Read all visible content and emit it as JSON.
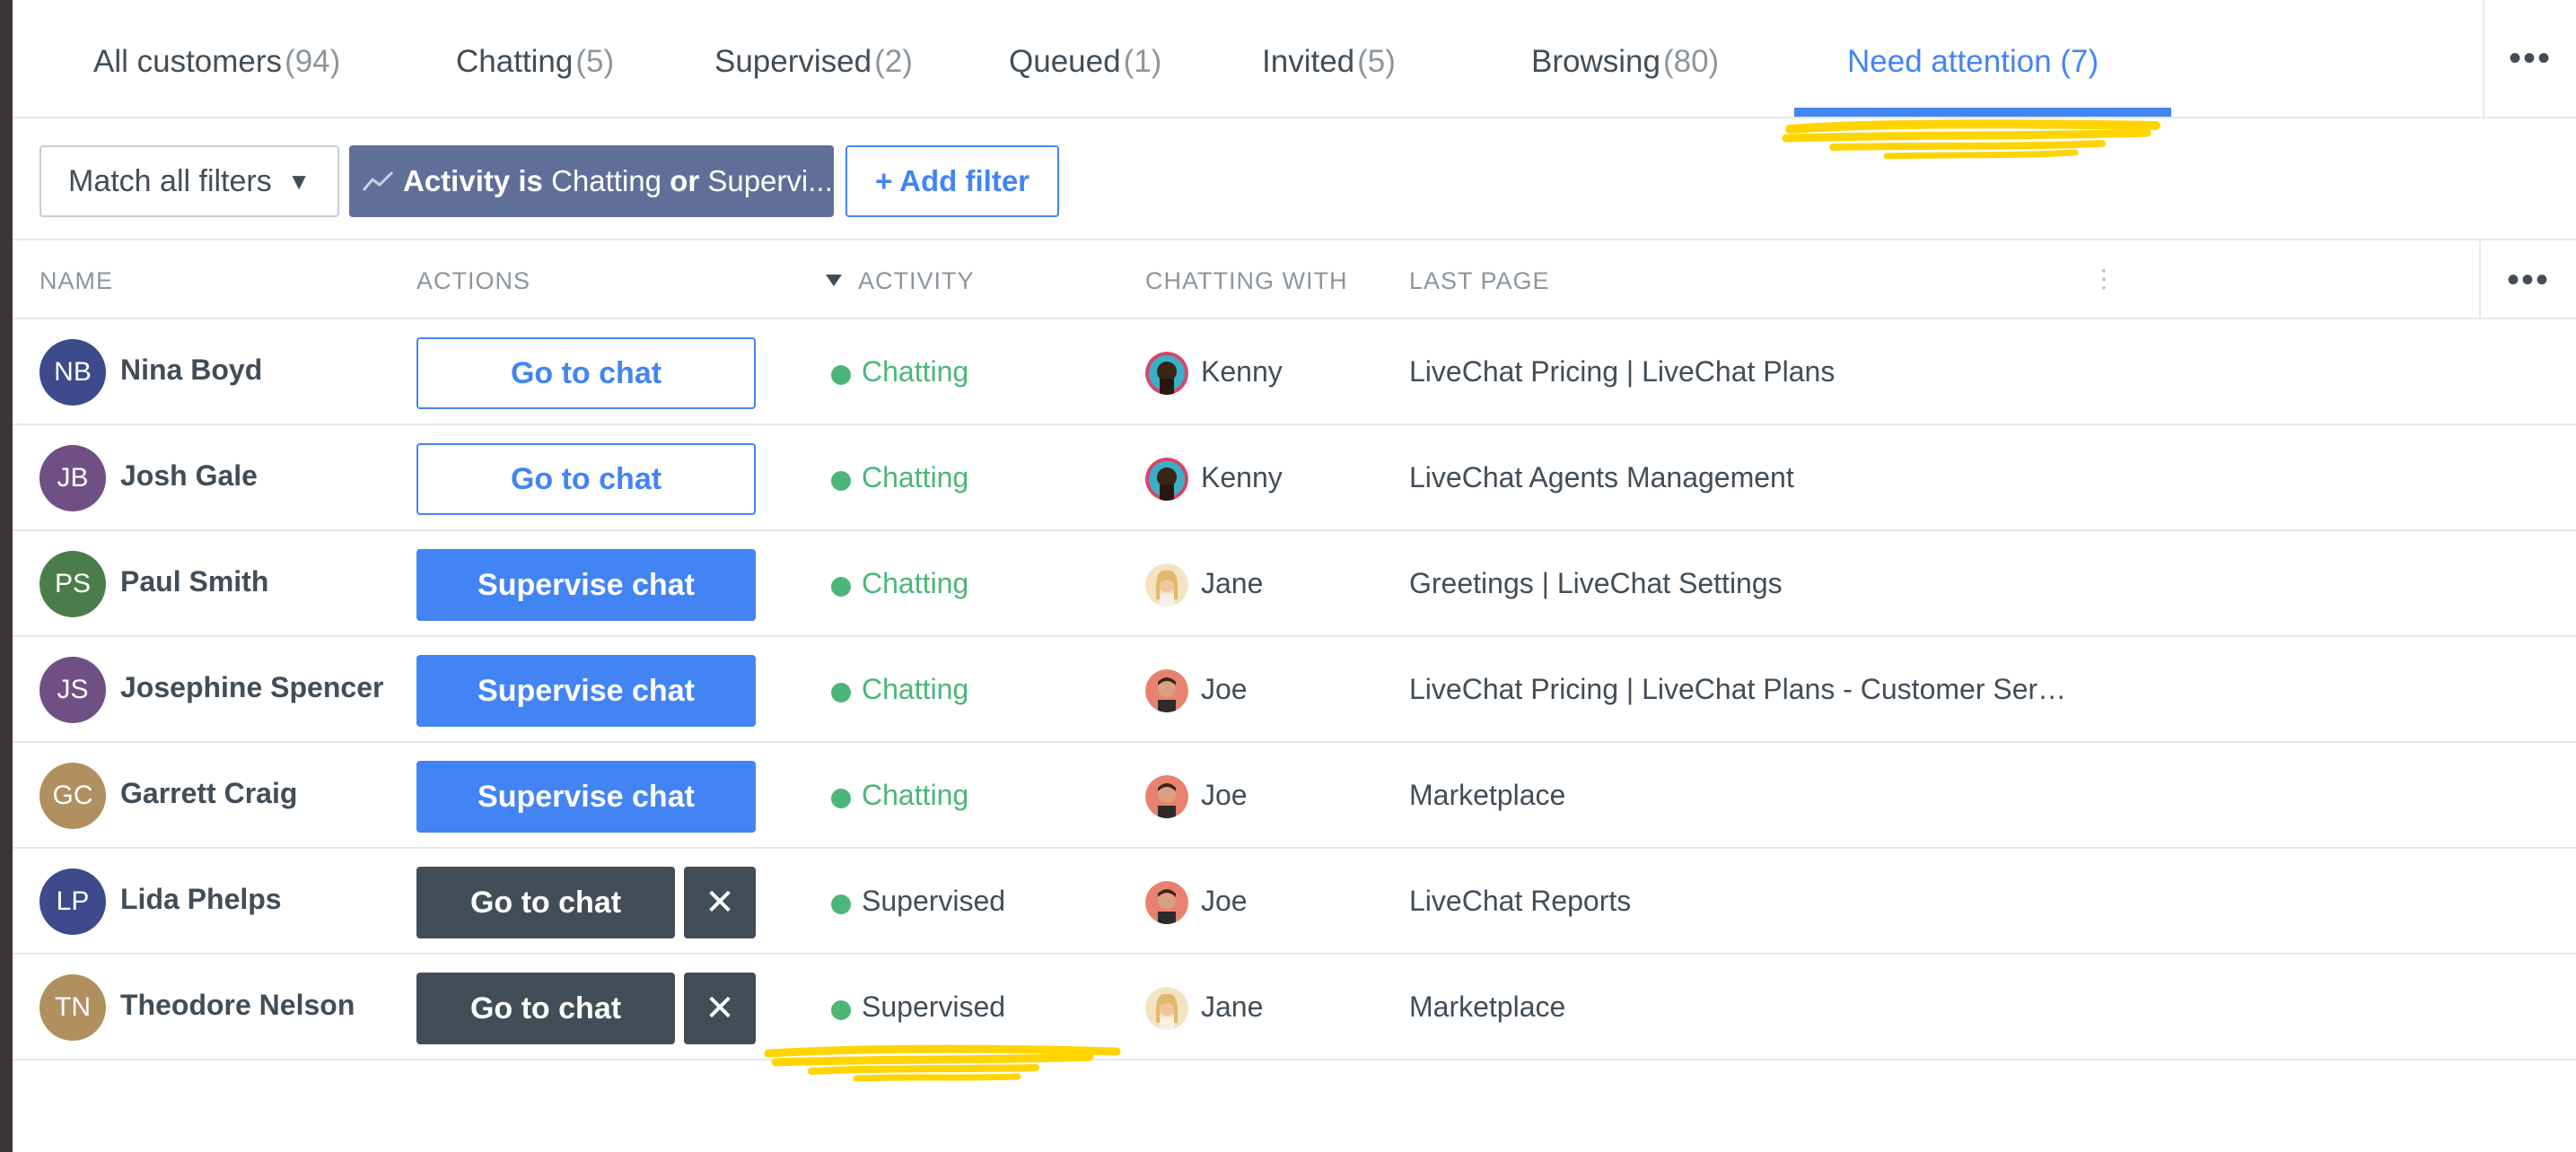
{
  "tabs": [
    {
      "label": "All customers",
      "count": "(94)"
    },
    {
      "label": "Chatting",
      "count": "(5)"
    },
    {
      "label": "Supervised",
      "count": "(2)"
    },
    {
      "label": "Queued",
      "count": "(1)"
    },
    {
      "label": "Invited",
      "count": "(5)"
    },
    {
      "label": "Browsing",
      "count": "(80)"
    },
    {
      "label": "Need attention (7)",
      "count": ""
    }
  ],
  "tabs_more": "•••",
  "filters": {
    "match": "Match all filters",
    "chip": {
      "part1": "Activity is",
      "part2": "Chatting",
      "part3": "or",
      "part4": "Supervi..."
    },
    "add": "+ Add filter"
  },
  "table": {
    "headers": {
      "name": "NAME",
      "actions": "ACTIONS",
      "activity": "ACTIVITY",
      "chatting_with": "CHATTING WITH",
      "last_page": "LAST PAGE"
    },
    "col_menu": "⋮",
    "more": "•••",
    "rows": [
      {
        "initials": "NB",
        "avatar_color": "#3d4a8b",
        "name": "Nina Boyd",
        "action": "Go to chat",
        "action_style": "outline",
        "status": "Chatting",
        "agent": "Kenny",
        "agent_icon": "kenny-avatar-icon",
        "last_page": "LiveChat Pricing | LiveChat Plans"
      },
      {
        "initials": "JB",
        "avatar_color": "#6f4f84",
        "name": "Josh Gale",
        "action": "Go to chat",
        "action_style": "outline",
        "status": "Chatting",
        "agent": "Kenny",
        "agent_icon": "kenny-avatar-icon",
        "last_page": "LiveChat Agents Management"
      },
      {
        "initials": "PS",
        "avatar_color": "#4b7d4c",
        "name": "Paul Smith",
        "action": "Supervise chat",
        "action_style": "primary",
        "status": "Chatting",
        "agent": "Jane",
        "agent_icon": "jane-avatar-icon",
        "last_page": "Greetings | LiveChat Settings"
      },
      {
        "initials": "JS",
        "avatar_color": "#6f4f84",
        "name": "Josephine Spencer",
        "action": "Supervise chat",
        "action_style": "primary",
        "status": "Chatting",
        "agent": "Joe",
        "agent_icon": "joe-avatar-icon",
        "last_page": "LiveChat Pricing | LiveChat Plans - Customer Service…"
      },
      {
        "initials": "GC",
        "avatar_color": "#b09060",
        "name": "Garrett Craig",
        "action": "Supervise chat",
        "action_style": "primary",
        "status": "Chatting",
        "agent": "Joe",
        "agent_icon": "joe-avatar-icon",
        "last_page": "Marketplace"
      },
      {
        "initials": "LP",
        "avatar_color": "#3d4a8b",
        "name": "Lida Phelps",
        "action": "Go to chat",
        "action_style": "dark",
        "close": "✕",
        "status": "Supervised",
        "agent": "Joe",
        "agent_icon": "joe-avatar-icon",
        "last_page": "LiveChat Reports"
      },
      {
        "initials": "TN",
        "avatar_color": "#b09060",
        "name": "Theodore Nelson",
        "action": "Go to chat",
        "action_style": "dark",
        "close": "✕",
        "status": "Supervised",
        "agent": "Jane",
        "agent_icon": "jane-avatar-icon",
        "last_page": "Marketplace"
      }
    ]
  },
  "colors": {
    "accent": "#4384f5",
    "chip": "#606f98",
    "dark_button": "#424d57",
    "chatting": "#4bb678",
    "highlight": "#ffd400"
  }
}
